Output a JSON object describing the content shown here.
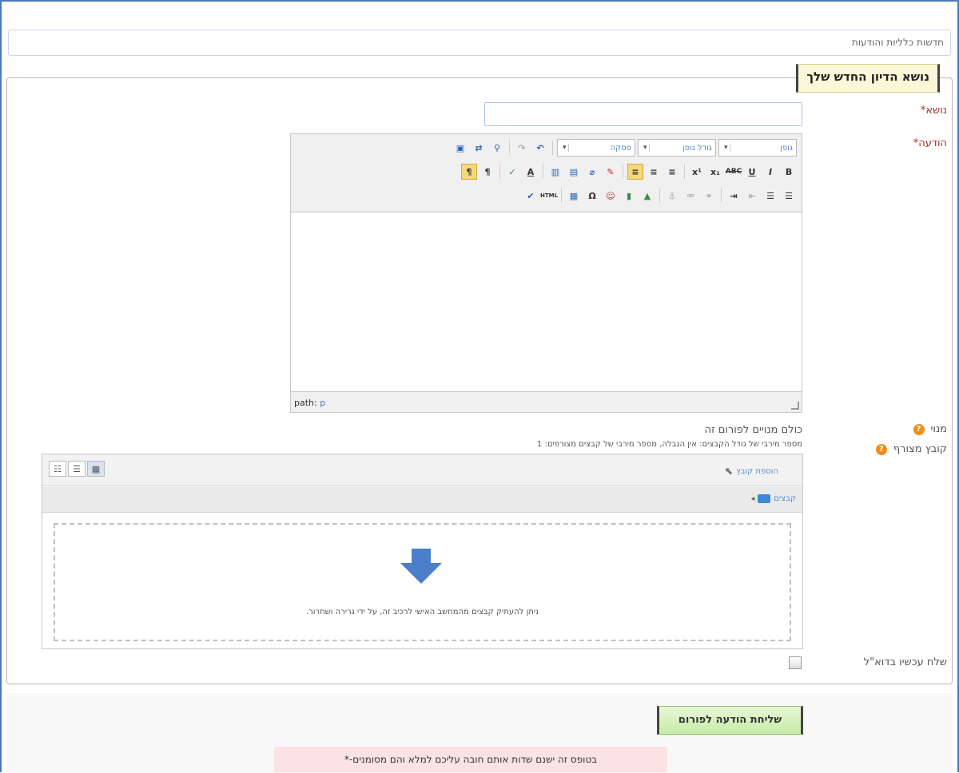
{
  "breadcrumb": "חדשות כלליות והודעות",
  "legend": "נושא הדיון החדש שלך",
  "fields": {
    "subject_label": "נושא",
    "message_label": "הודעה",
    "subscription_label": "מנוי",
    "attachment_label": "קובץ מצורף",
    "mail_now_label": "שלח עכשיו בדוא\"ל",
    "required_mark": "*"
  },
  "editor": {
    "font_select": "גופן",
    "size_select": "גודל גופן",
    "paragraph_select": "פסקה",
    "path_label": "path:",
    "path_value": "p"
  },
  "subscription_text": "כולם מנויים לפורום זה",
  "attachment_info": "מספר מירבי של גודל הקבצים: אין הגבלה, מספר מירבי של קבצים מצורפים: 1",
  "filepicker": {
    "add_file": "הוספת קובץ",
    "folder_label": "קבצים",
    "drop_text": "ניתן להעתיק קבצים מהמחשב האישי לרכיב זה, על ידי גרירה ושחרור."
  },
  "submit_label": "שליחת הודעה לפורום",
  "required_note": "בטופס זה ישנם שדות אותם חובה עליכם למלא והם מסומנים-*",
  "help_icon_glyph": "?"
}
